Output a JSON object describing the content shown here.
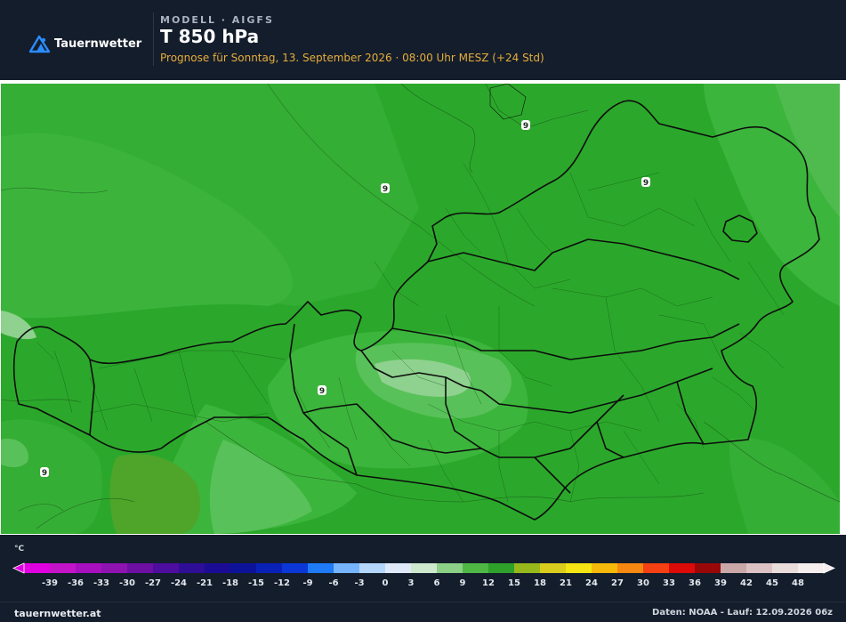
{
  "header": {
    "brand": "Tauernwetter",
    "model_label": "MODELL · AIGFS",
    "title": "T 850 hPa",
    "forecast": "Prognose für Sonntag, 13. September 2026 · 08:00 Uhr MESZ  (+24 Std)"
  },
  "map": {
    "isotherm_labels": [
      "9",
      "9",
      "9",
      "9",
      "9"
    ],
    "fill_colors": {
      "base": "#2ba82b",
      "light": "#3cb53c",
      "lighter": "#59c159",
      "pale": "#8fd18f",
      "darker": "#24a324",
      "olive": "#4ea52a"
    },
    "border_color": "#111111"
  },
  "legend": {
    "unit": "°C",
    "ticks": [
      "-39",
      "-36",
      "-33",
      "-30",
      "-27",
      "-24",
      "-21",
      "-18",
      "-15",
      "-12",
      "-9",
      "-6",
      "-3",
      "0",
      "3",
      "6",
      "9",
      "12",
      "15",
      "18",
      "21",
      "24",
      "27",
      "30",
      "33",
      "36",
      "39",
      "42",
      "45",
      "48"
    ],
    "colors": [
      "#e100e1",
      "#c314c8",
      "#a80fbf",
      "#8e13b1",
      "#6d0fa3",
      "#4d0d9e",
      "#2e0d97",
      "#1a0c95",
      "#0d1399",
      "#0a21b8",
      "#0a37d6",
      "#1e7bf5",
      "#76b4fb",
      "#b5d6fb",
      "#dfe9f7",
      "#cde8cc",
      "#8ccf87",
      "#4fb845",
      "#2ea12a",
      "#97b81b",
      "#d9cc1d",
      "#f5e413",
      "#f6b80b",
      "#f68710",
      "#f44012",
      "#dd0a0a",
      "#990808",
      "#caa8a8",
      "#dcc2c2",
      "#ebdcdc",
      "#f5eeee"
    ]
  },
  "footer": {
    "site": "tauernwetter.at",
    "credit": "Daten: NOAA - Lauf: 12.09.2026 06z"
  }
}
